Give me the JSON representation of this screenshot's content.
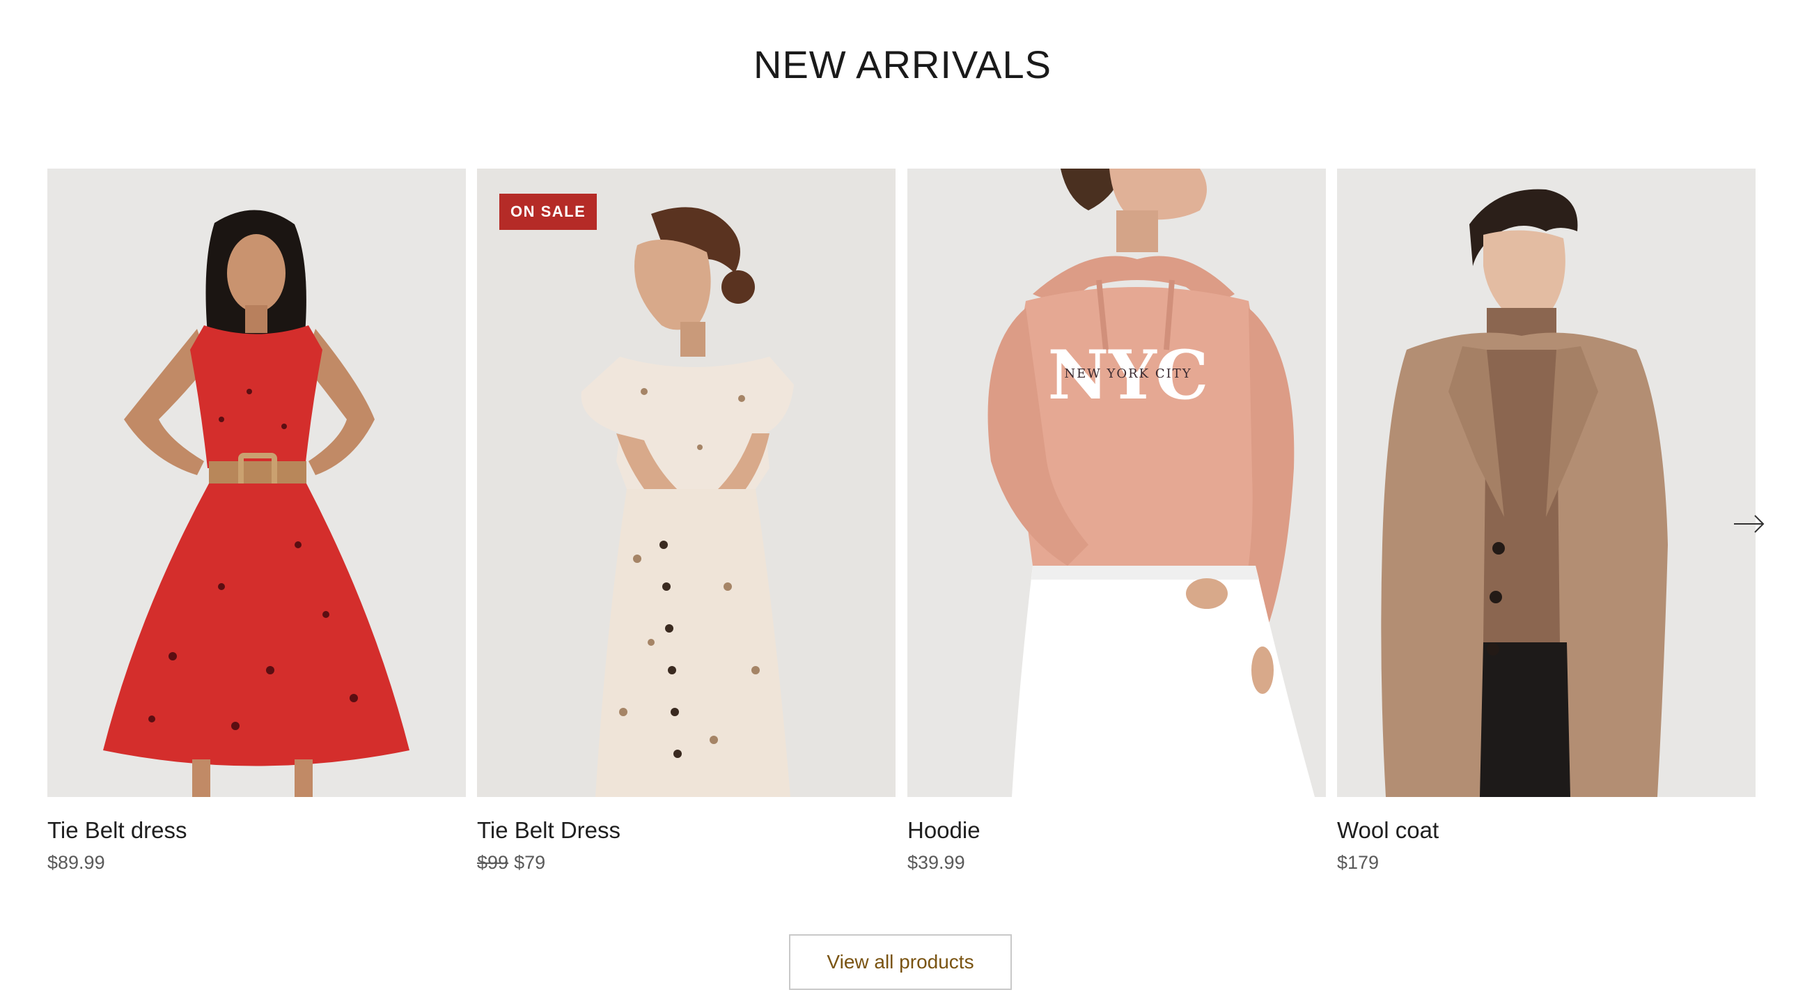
{
  "section": {
    "title": "NEW ARRIVALS"
  },
  "products": [
    {
      "name": "Tie Belt dress",
      "price": "$89.99",
      "image": "red-floral-dress-photo"
    },
    {
      "name": "Tie Belt Dress",
      "badge": "ON SALE",
      "old_price": "$99",
      "price": "$79",
      "image": "cream-floral-dress-photo"
    },
    {
      "name": "Hoodie",
      "price": "$39.99",
      "image": "pink-nyc-hoodie-photo",
      "print_big": "NYC",
      "print_small": "NEW YORK CITY"
    },
    {
      "name": "Wool coat",
      "price": "$179",
      "image": "camel-wool-coat-photo"
    }
  ],
  "carousel": {
    "next_icon": "arrow-right-icon"
  },
  "view_all": {
    "label": "View all products"
  },
  "colors": {
    "badge": "#b52b27",
    "button_text": "#7a5412",
    "image_bg": "#e8e7e5"
  }
}
